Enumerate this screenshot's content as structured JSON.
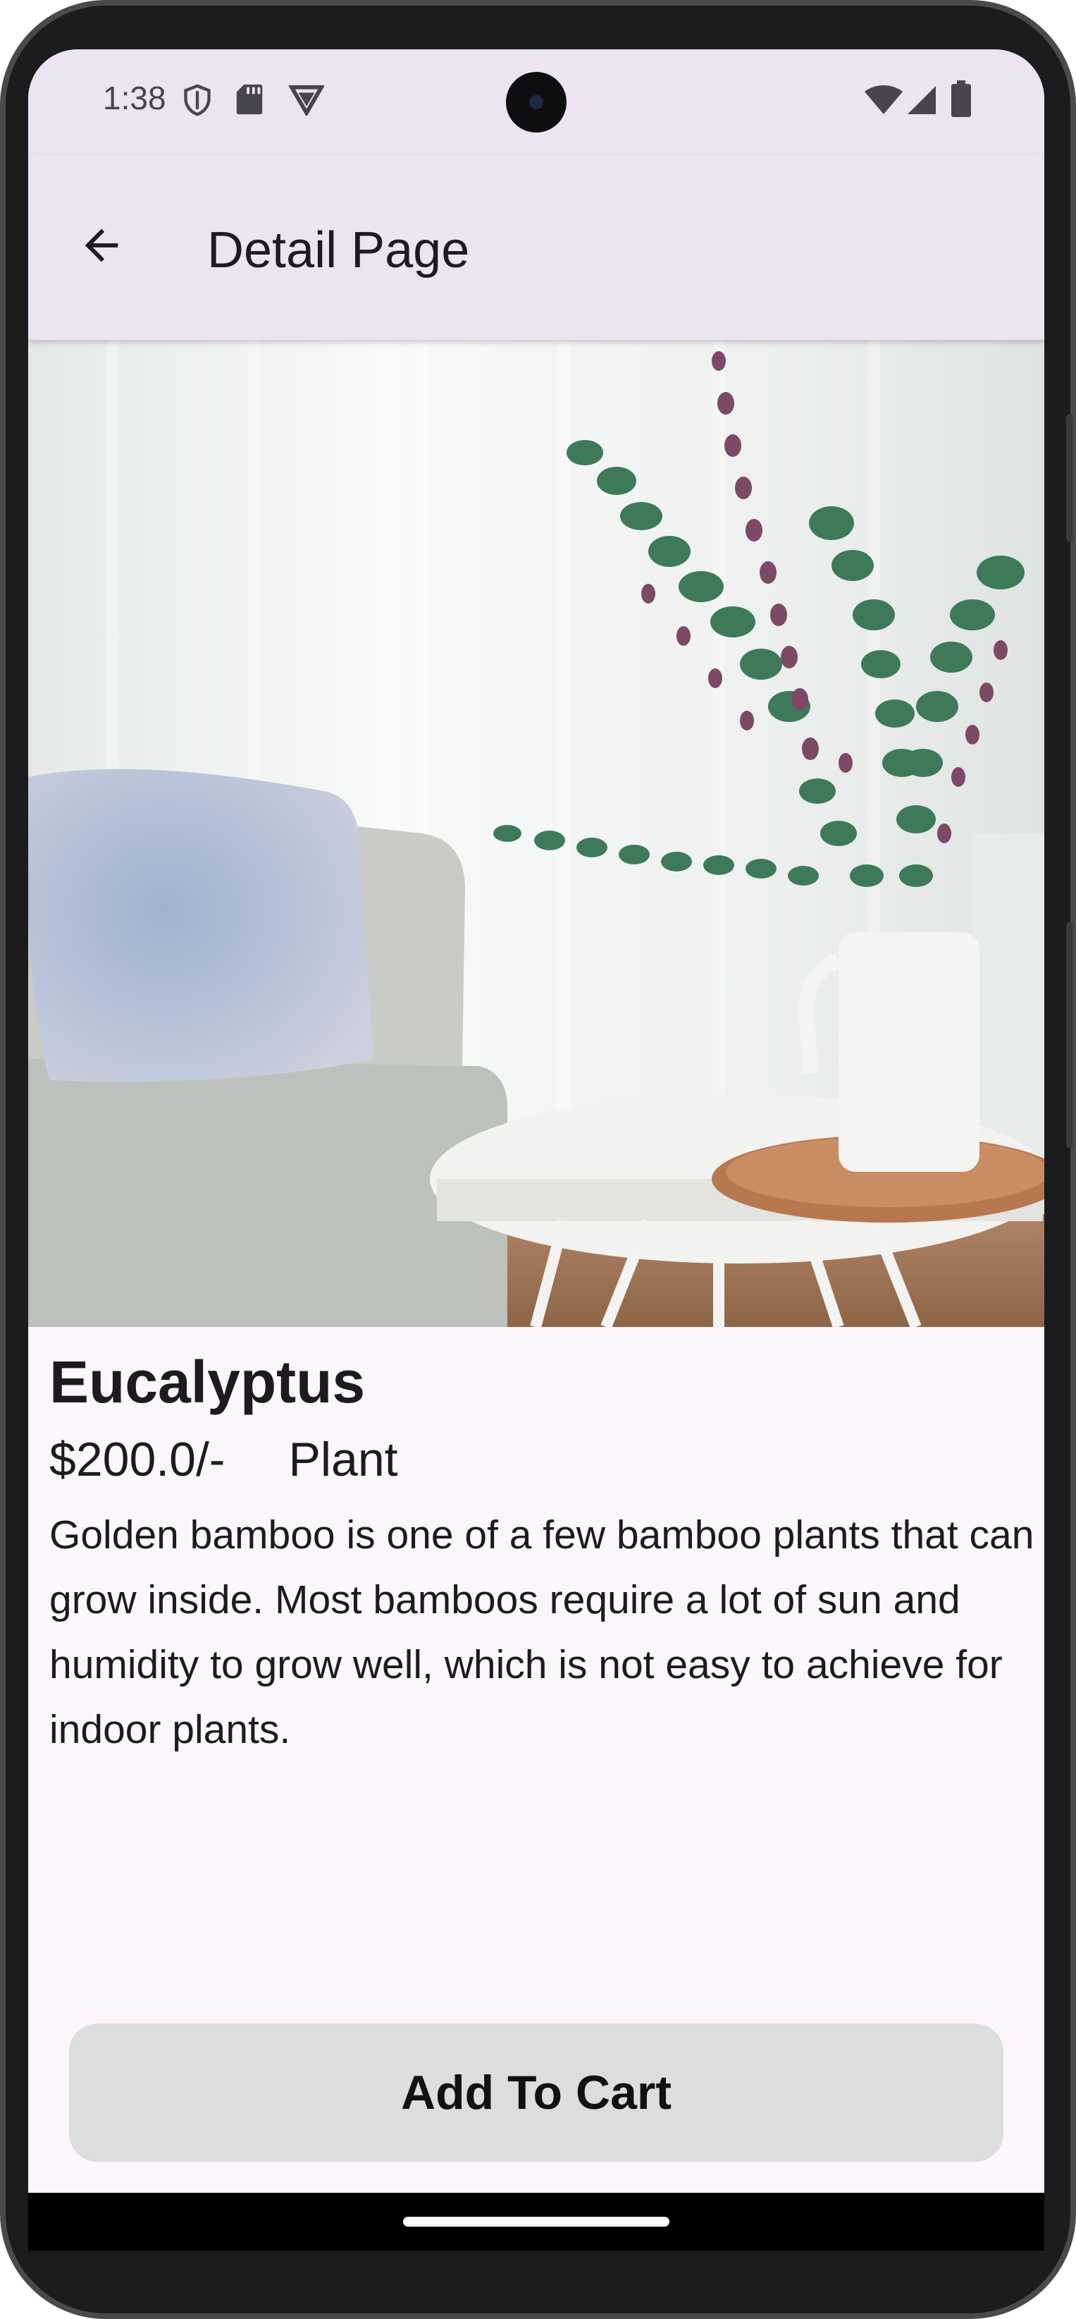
{
  "status_bar": {
    "time": "1:38",
    "icons": [
      "shield-icon",
      "sd-card-icon",
      "vpn-icon",
      "wifi-icon",
      "signal-icon",
      "battery-icon"
    ]
  },
  "app_bar": {
    "title": "Detail Page",
    "back_icon": "arrow-back-icon"
  },
  "product": {
    "image": "eucalyptus-plant-photo",
    "name": "Eucalyptus",
    "price": "$200.0/-",
    "category": "Plant",
    "description": "Golden bamboo is one of a few bamboo plants that can grow inside. Most bamboos require a lot of sun and humidity to grow well, which is not easy to achieve for indoor plants."
  },
  "actions": {
    "add_to_cart_label": "Add To Cart"
  },
  "colors": {
    "app_bar_bg": "#ede4f1",
    "page_bg": "#fcf5fc",
    "button_bg": "#dddddd",
    "text": "#1d1b20"
  }
}
